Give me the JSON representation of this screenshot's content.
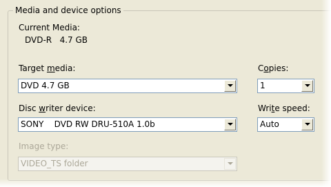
{
  "group": {
    "title": "Media and device options"
  },
  "current_media": {
    "label": "Current Media:",
    "value": "DVD-R   4.7 GB"
  },
  "target_media": {
    "label_before": "Target ",
    "label_key": "m",
    "label_after": "edia:",
    "value": "DVD 4.7 GB"
  },
  "copies": {
    "label_before": "C",
    "label_key": "o",
    "label_after": "pies:",
    "value": "1"
  },
  "disc_writer": {
    "label_before": "Disc ",
    "label_key": "w",
    "label_after": "riter device:",
    "value": "SONY    DVD RW DRU-510A 1.0b"
  },
  "write_speed": {
    "label_before": "Wri",
    "label_key": "t",
    "label_after": "e speed:",
    "value": "Auto"
  },
  "image_type": {
    "label": "Image type:",
    "value": "VIDEO_TS folder"
  }
}
